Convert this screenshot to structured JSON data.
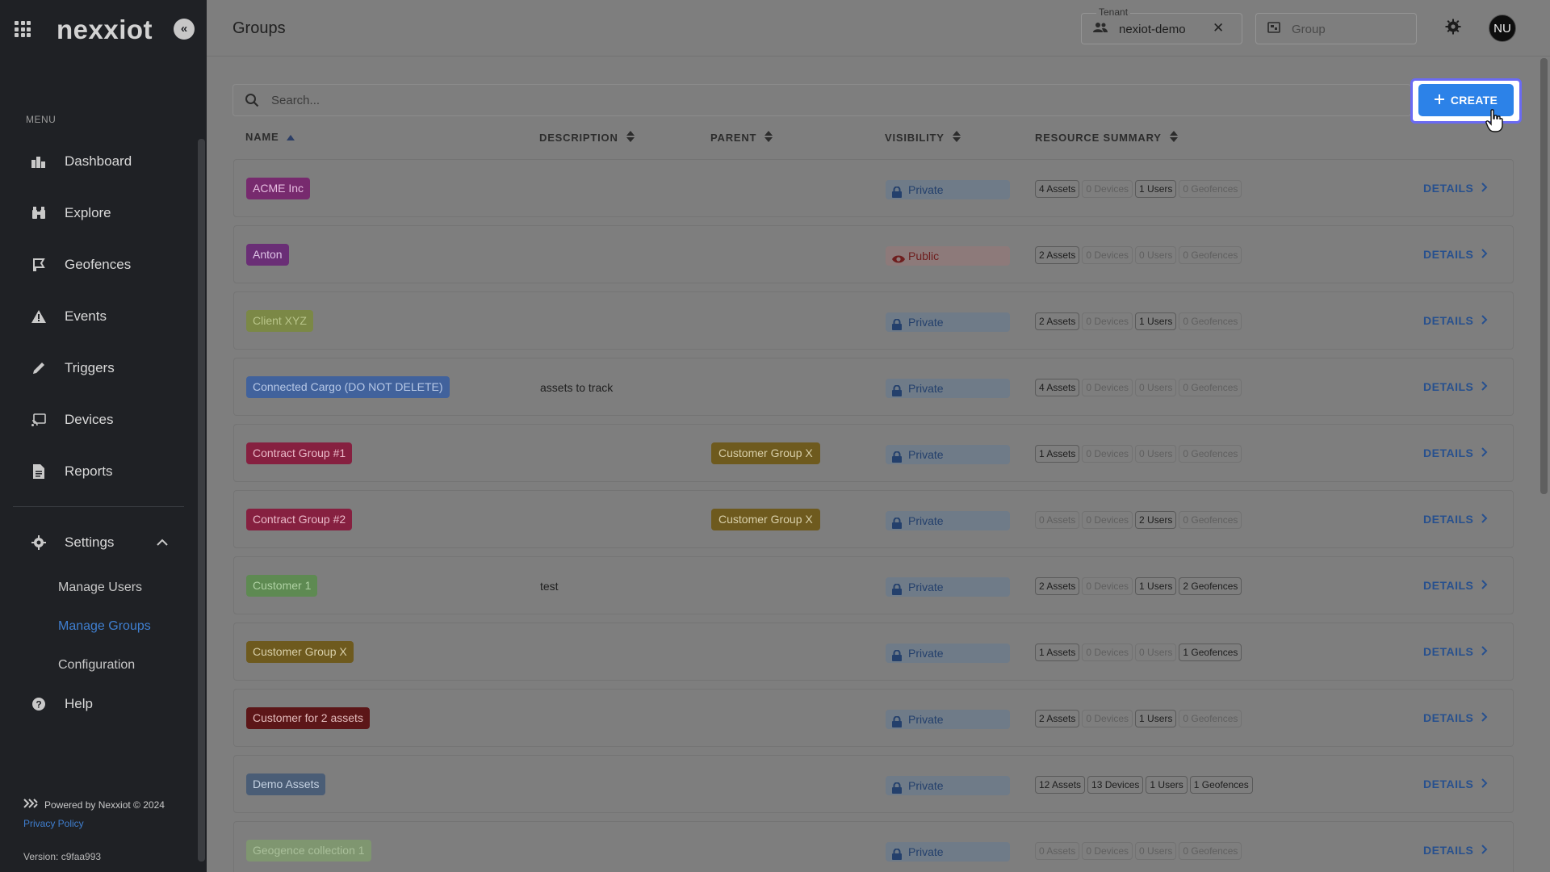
{
  "sidebar": {
    "brand": "nexxiot",
    "menu_label": "MENU",
    "items": [
      {
        "label": "Dashboard",
        "icon": "dashboard-icon"
      },
      {
        "label": "Explore",
        "icon": "binoculars-icon"
      },
      {
        "label": "Geofences",
        "icon": "geofence-icon"
      },
      {
        "label": "Events",
        "icon": "warning-icon"
      },
      {
        "label": "Triggers",
        "icon": "pencil-icon"
      },
      {
        "label": "Devices",
        "icon": "device-icon"
      },
      {
        "label": "Reports",
        "icon": "report-icon"
      },
      {
        "label": "Settings",
        "icon": "gear-icon"
      }
    ],
    "settings_sub": [
      "Manage Users",
      "Manage Groups",
      "Configuration"
    ],
    "help_label": "Help",
    "footer": {
      "powered": "Powered by Nexxiot © 2024",
      "privacy": "Privacy Policy",
      "version": "Version: c9faa993"
    }
  },
  "header": {
    "title": "Groups",
    "tenant_label": "Tenant",
    "tenant_value": "nexiot-demo",
    "group_placeholder": "Group",
    "avatar_initials": "NU"
  },
  "toolbar": {
    "search_placeholder": "Search...",
    "create_label": "CREATE"
  },
  "columns": [
    "NAME",
    "DESCRIPTION",
    "PARENT",
    "VISIBILITY",
    "RESOURCE SUMMARY"
  ],
  "details_label": "DETAILS",
  "colors": {
    "accent": "#2c82e8",
    "highlight_ring": "#6a6af3"
  },
  "groups": [
    {
      "name": "ACME Inc",
      "chip_bg": "#772a6e",
      "chip_fg": "#e6bde0",
      "description": "",
      "parent": "",
      "visibility": "Private",
      "resources": [
        "4 Assets",
        "0 Devices",
        "1 Users",
        "0 Geofences"
      ],
      "active": [
        true,
        false,
        true,
        false
      ]
    },
    {
      "name": "Anton",
      "chip_bg": "#6a2e76",
      "chip_fg": "#dec3e6",
      "description": "",
      "parent": "",
      "visibility": "Public",
      "resources": [
        "2 Assets",
        "0 Devices",
        "0 Users",
        "0 Geofences"
      ],
      "active": [
        true,
        false,
        false,
        false
      ]
    },
    {
      "name": "Client XYZ",
      "chip_bg": "#7b8846",
      "chip_fg": "#b8c489",
      "description": "",
      "parent": "",
      "visibility": "Private",
      "resources": [
        "2 Assets",
        "0 Devices",
        "1 Users",
        "0 Geofences"
      ],
      "active": [
        true,
        false,
        true,
        false
      ]
    },
    {
      "name": "Connected Cargo (DO NOT DELETE)",
      "chip_bg": "#41629c",
      "chip_fg": "#b7c8e6",
      "description": "assets to track",
      "parent": "",
      "visibility": "Private",
      "resources": [
        "4 Assets",
        "0 Devices",
        "0 Users",
        "0 Geofences"
      ],
      "active": [
        true,
        false,
        false,
        false
      ]
    },
    {
      "name": "Contract Group #1",
      "chip_bg": "#862040",
      "chip_fg": "#eab9c8",
      "description": "",
      "parent": "Customer Group X",
      "visibility": "Private",
      "resources": [
        "1 Assets",
        "0 Devices",
        "0 Users",
        "0 Geofences"
      ],
      "active": [
        true,
        false,
        false,
        false
      ]
    },
    {
      "name": "Contract Group #2",
      "chip_bg": "#862040",
      "chip_fg": "#eab9c8",
      "description": "",
      "parent": "Customer Group X",
      "visibility": "Private",
      "resources": [
        "0 Assets",
        "0 Devices",
        "2 Users",
        "0 Geofences"
      ],
      "active": [
        false,
        false,
        true,
        false
      ]
    },
    {
      "name": "Customer 1",
      "chip_bg": "#5e8a52",
      "chip_fg": "#aed0a2",
      "description": "test",
      "parent": "",
      "visibility": "Private",
      "resources": [
        "2 Assets",
        "0 Devices",
        "1 Users",
        "2 Geofences"
      ],
      "active": [
        true,
        false,
        true,
        true
      ]
    },
    {
      "name": "Customer Group X",
      "chip_bg": "#6e5a1e",
      "chip_fg": "#d8cfa9",
      "description": "",
      "parent": "",
      "visibility": "Private",
      "resources": [
        "1 Assets",
        "0 Devices",
        "0 Users",
        "1 Geofences"
      ],
      "active": [
        true,
        false,
        false,
        true
      ]
    },
    {
      "name": "Customer for 2 assets",
      "chip_bg": "#5c1618",
      "chip_fg": "#e4bcbc",
      "description": "",
      "parent": "",
      "visibility": "Private",
      "resources": [
        "2 Assets",
        "0 Devices",
        "1 Users",
        "0 Geofences"
      ],
      "active": [
        true,
        false,
        true,
        false
      ]
    },
    {
      "name": "Demo Assets",
      "chip_bg": "#4a5d76",
      "chip_fg": "#c5d2e2",
      "description": "",
      "parent": "",
      "visibility": "Private",
      "resources": [
        "12 Assets",
        "13 Devices",
        "1 Users",
        "1 Geofences"
      ],
      "active": [
        true,
        true,
        true,
        true
      ]
    },
    {
      "name": "Geogence collection 1",
      "chip_bg": "#7f9670",
      "chip_fg": "#a9bf9a",
      "description": "",
      "parent": "",
      "visibility": "Private",
      "resources": [
        "0 Assets",
        "0 Devices",
        "0 Users",
        "0 Geofences"
      ],
      "active": [
        false,
        false,
        false,
        false
      ]
    }
  ]
}
